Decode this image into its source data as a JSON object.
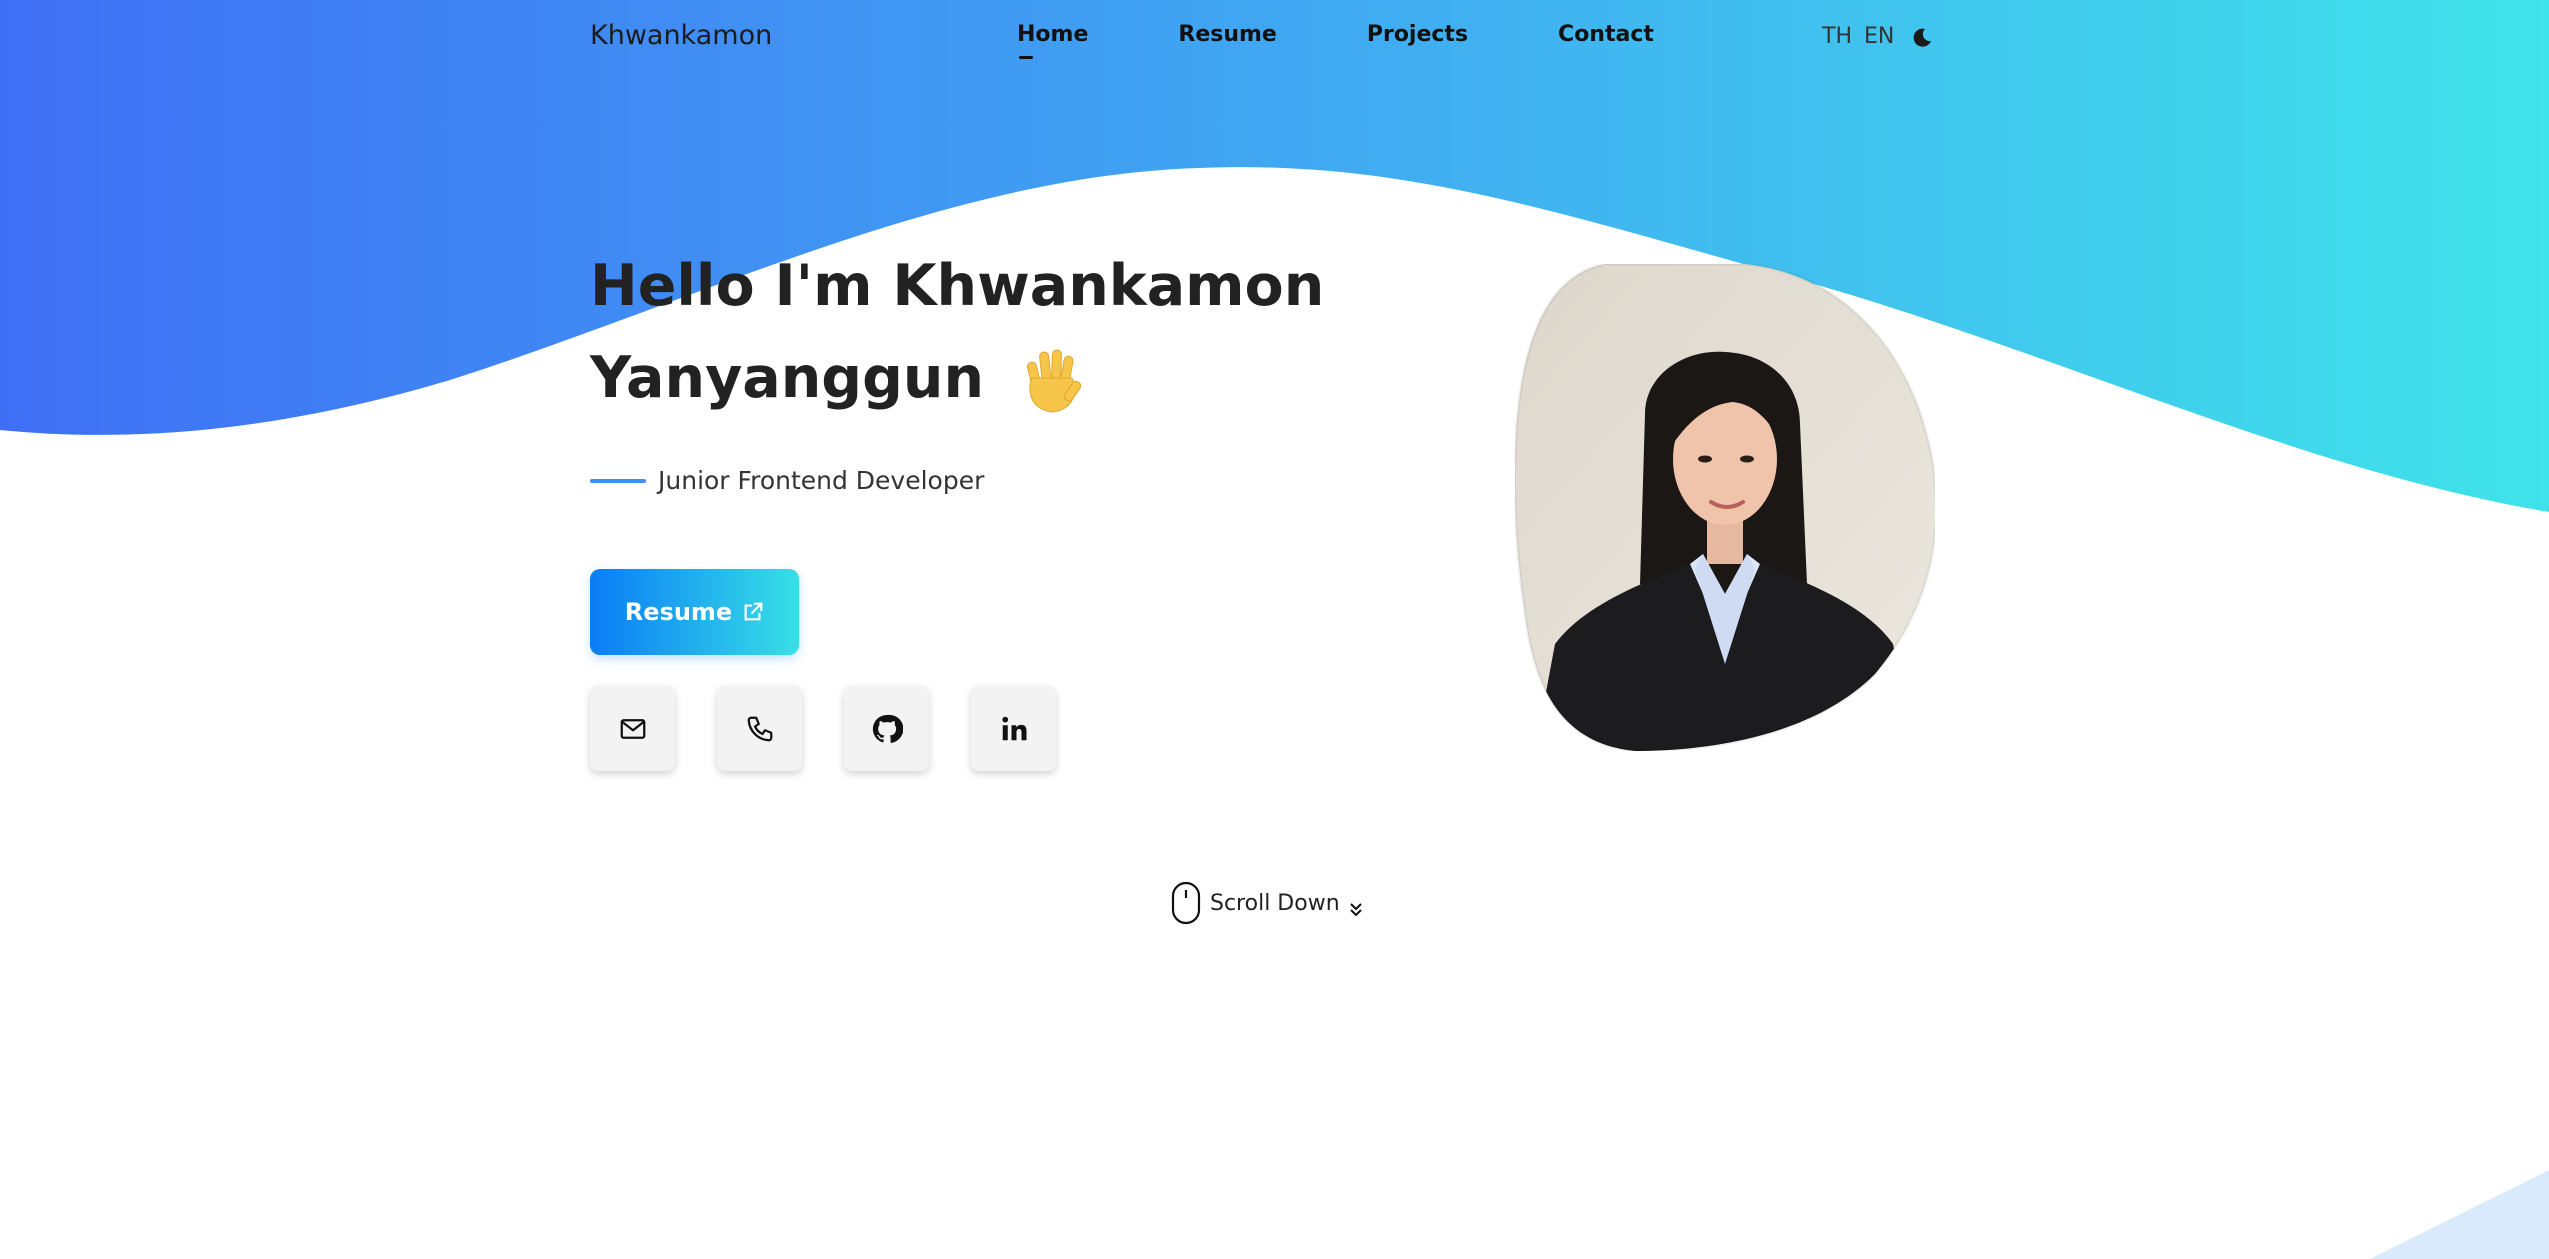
{
  "header": {
    "brand": "Khwankamon",
    "nav": [
      {
        "label": "Home",
        "active": true
      },
      {
        "label": "Resume",
        "active": false
      },
      {
        "label": "Projects",
        "active": false
      },
      {
        "label": "Contact",
        "active": false
      }
    ],
    "languages": [
      "TH",
      "EN"
    ],
    "theme_icon": "moon-icon"
  },
  "hero": {
    "greeting_line1": "Hello I'm Khwankamon",
    "greeting_line2": "Yanyanggun",
    "emoji": "🖐",
    "role": "Junior Frontend Developer",
    "resume_button": "Resume",
    "resume_icon": "external-link-icon",
    "socials": [
      "mail-icon",
      "phone-icon",
      "github-icon",
      "linkedin-icon"
    ]
  },
  "scroll": {
    "label": "Scroll Down",
    "icons": [
      "mouse-icon",
      "chevrons-down-icon"
    ]
  },
  "colors": {
    "gradient_start": "#3f6ff5",
    "gradient_end": "#3fe3ea",
    "button_start": "#0a7cf6",
    "button_end": "#37e0e5",
    "accent_line": "#3b8ef3"
  }
}
